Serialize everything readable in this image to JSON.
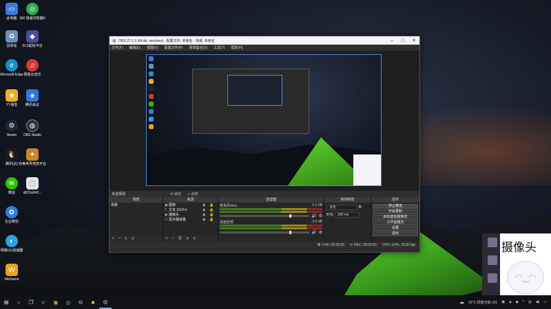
{
  "desktop": {
    "icons": [
      {
        "label": "此电脑",
        "icon": "computer-icon",
        "color": "#3a7bd5"
      },
      {
        "label": "360 极速浏览器X",
        "icon": "browser-icon",
        "color": "#2ea84f"
      },
      {
        "label": "回收站",
        "icon": "recycle-bin-icon",
        "color": "#6c8fb3"
      },
      {
        "label": "SLS起始平台",
        "icon": "platform-icon",
        "color": "#4b4b9c"
      },
      {
        "label": "Microsoft Edge",
        "icon": "edge-icon",
        "color": "#1a8fc9"
      },
      {
        "label": "网易云音乐",
        "icon": "music-icon",
        "color": "#d63a30"
      },
      {
        "label": "YY语音",
        "icon": "yy-icon",
        "color": "#f2b01e"
      },
      {
        "label": "腾讯会议",
        "icon": "meeting-icon",
        "color": "#2a74e8"
      },
      {
        "label": "Steam",
        "icon": "steam-icon",
        "color": "#1b2838"
      },
      {
        "label": "OBS Studio",
        "icon": "obs-icon",
        "color": "#302e31"
      },
      {
        "label": "腾讯QQ",
        "icon": "qq-icon",
        "color": "#1b1b1b"
      },
      {
        "label": "完美世界竞技平台",
        "icon": "game-platform-icon",
        "color": "#c8842a"
      },
      {
        "label": "微信",
        "icon": "wechat-icon",
        "color": "#2dc100"
      },
      {
        "label": "d021a943...",
        "icon": "image-file-icon",
        "color": "#e5e5e5"
      },
      {
        "label": "企业微信",
        "icon": "wecom-icon",
        "color": "#2f7de1"
      },
      {
        "label": "网易UU加速器",
        "icon": "uu-icon",
        "color": "#2fa0e0"
      },
      {
        "label": "WeGame",
        "icon": "wegame-icon",
        "color": "#e8a11a"
      }
    ]
  },
  "obs": {
    "title": "OBS 27.1.3 (64-bit, windows) - 配置文件: 未命名 - 场景: 未命名",
    "menu": [
      "文件(F)",
      "编辑(E)",
      "视图(V)",
      "配置文件(P)",
      "场景集合(S)",
      "工具(T)",
      "帮助(H)"
    ],
    "docks_label": "未选择源",
    "dock_controls": [
      "属性",
      "滤镜"
    ],
    "scenes": {
      "header": "场景",
      "items": [
        "场景"
      ]
    },
    "sources": {
      "header": "来源",
      "items": [
        {
          "icon": "monitor-icon",
          "glyph": "▣",
          "name": "图像"
        },
        {
          "icon": "text-icon",
          "glyph": "T",
          "name": "文本 (GDI+)"
        },
        {
          "icon": "camera-icon",
          "glyph": "◉",
          "name": "摄像头"
        },
        {
          "icon": "display-icon",
          "glyph": "▭",
          "name": "显示器采集"
        }
      ]
    },
    "mixer": {
      "header": "混音器",
      "channels": [
        {
          "name": "麦克风/Aux",
          "db": "0.0 dB"
        },
        {
          "name": "桌面音频",
          "db": "-3.0 dB"
        }
      ]
    },
    "transitions": {
      "header": "转场特效",
      "type": "淡化",
      "duration_label": "时长",
      "duration": "300 ms"
    },
    "controls": {
      "header": "控件",
      "buttons": [
        "停止推流",
        "开始录制",
        "启动虚拟摄像机",
        "工作室模式",
        "设置",
        "退出"
      ]
    },
    "status": {
      "live": "LIVE: 00:00:00",
      "rec": "REC: 00:00:00",
      "cpu": "CPU: 3.0%, 30.00 fps"
    }
  },
  "webcam_overlay": {
    "label": "摄像头"
  },
  "taskbar": {
    "weather": "16°C 轻度污染 101",
    "icons": [
      "windows-start-icon",
      "search-icon",
      "task-view-icon",
      "edge-icon",
      "chrome-icon",
      "obs-icon",
      "steam-icon",
      "yellow-app-icon",
      "camera-app-icon"
    ]
  }
}
